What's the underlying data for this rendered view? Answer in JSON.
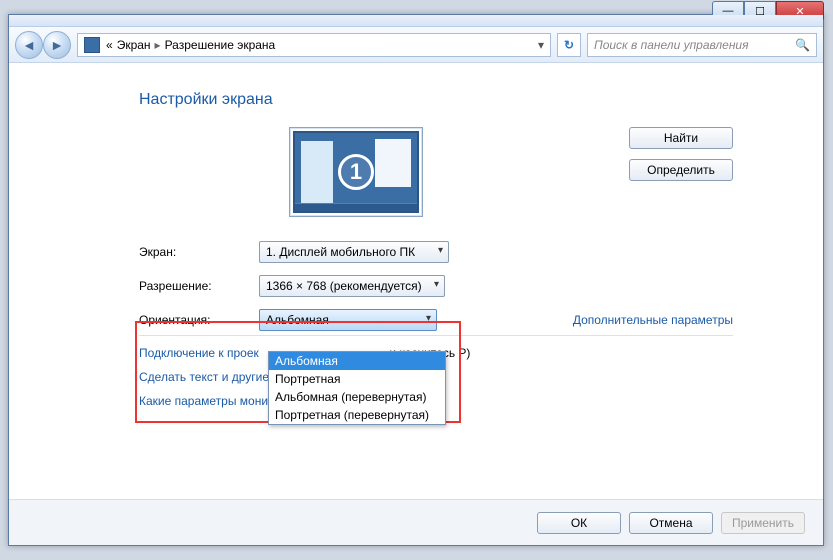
{
  "windowControls": {
    "min": "—",
    "max": "☐",
    "close": "✕"
  },
  "nav": {
    "crumb0": "«",
    "crumb1": "Экран",
    "crumb2": "Разрешение экрана",
    "searchPlaceholder": "Поиск в панели управления"
  },
  "page": {
    "title": "Настройки экрана",
    "monitorNumber": "1",
    "findBtn": "Найти",
    "detectBtn": "Определить"
  },
  "form": {
    "screenLabel": "Экран:",
    "screenValue": "1. Дисплей мобильного ПК",
    "resLabel": "Разрешение:",
    "resValue": "1366 × 768 (рекомендуется)",
    "orientLabel": "Ориентация:",
    "orientValue": "Альбомная",
    "orientOptions": {
      "o1": "Альбомная",
      "o2": "Портретная",
      "o3": "Альбомная (перевернутая)",
      "o4": "Портретная (перевернутая)"
    }
  },
  "links": {
    "advanced": "Дополнительные параметры",
    "projectorPre": "Подключение к проек",
    "projectorPost": "и коснитесь P)",
    "textsize": "Сделать текст и другие элементы больше или меньше",
    "whichmon": "Какие параметры монитора следует выбрать?"
  },
  "footer": {
    "ok": "ОК",
    "cancel": "Отмена",
    "apply": "Применить"
  }
}
